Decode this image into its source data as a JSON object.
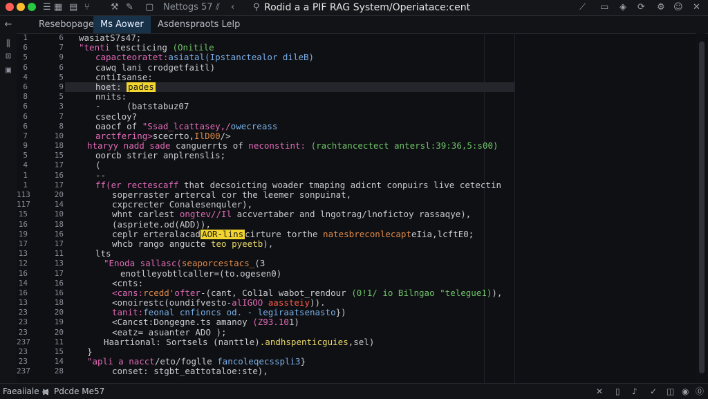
{
  "titlebar": {
    "tab_label": "Nettogs 57",
    "title": "Rodid a a PIF RAG System/Operiatace:cent",
    "colors": {
      "close": "#ff5f57",
      "minimize": "#febc2e",
      "maximize": "#28c840"
    }
  },
  "tabs": [
    {
      "label": "Resebopage",
      "active": false
    },
    {
      "label": "Ms Aower",
      "active": true
    },
    {
      "label": "Asdenspraots  Lelp",
      "active": false
    }
  ],
  "gutter_a": [
    "1",
    "6",
    "5",
    "6",
    "4",
    "6",
    "8",
    "6",
    "6",
    "6",
    "7",
    "9",
    "5",
    "4",
    "1",
    "1",
    "113",
    "117",
    "15",
    "16",
    "19",
    "17",
    "13",
    "12",
    "16",
    "14",
    "16",
    "13",
    "23",
    "23",
    "23",
    "237",
    "23",
    "23",
    "237"
  ],
  "gutter_b": [
    "6",
    "7",
    "9",
    "6",
    "5",
    "9",
    "5",
    "3",
    "7",
    "8",
    "10",
    "18",
    "15",
    "17",
    "16",
    "17",
    "20",
    "14",
    "10",
    "18",
    "16",
    "17",
    "11",
    "13",
    "17",
    "16",
    "16",
    "18",
    "20",
    "19",
    "20",
    "11",
    "15",
    "14",
    "28"
  ],
  "code_lines": [
    {
      "indent": 0,
      "parts": [
        [
          "",
          "wasiatS7s47;"
        ]
      ]
    },
    {
      "indent": 0,
      "parts": [
        [
          "kw",
          "\"tenti "
        ],
        [
          "",
          "tescticing "
        ],
        [
          "st",
          "(Onitile"
        ]
      ]
    },
    {
      "indent": 2,
      "parts": [
        [
          "kw",
          "capacteoratet:"
        ],
        [
          "bl",
          "asiatal(Ipstanctealor dileB)"
        ]
      ]
    },
    {
      "indent": 2,
      "parts": [
        [
          "",
          "cawq lani crodgetfaitl)"
        ]
      ]
    },
    {
      "indent": 2,
      "parts": [
        [
          "",
          "cntiIsanse:"
        ]
      ]
    },
    {
      "indent": 2,
      "parts": [
        [
          "",
          "hoet: "
        ],
        [
          "mk",
          "pades"
        ]
      ],
      "highlight": true
    },
    {
      "indent": 2,
      "parts": [
        [
          "",
          "nnits:"
        ]
      ]
    },
    {
      "indent": 2,
      "parts": [
        [
          "",
          "-     (batstabuz07"
        ]
      ]
    },
    {
      "indent": 2,
      "parts": [
        [
          "",
          "csecloy?"
        ]
      ]
    },
    {
      "indent": 2,
      "parts": [
        [
          "",
          "oaocf of "
        ],
        [
          "kw",
          "\"Ssad_lcattasey,/"
        ],
        [
          "bl",
          "owecreass"
        ]
      ]
    },
    {
      "indent": 2,
      "parts": [
        [
          "kw",
          "arctfering>"
        ],
        [
          "",
          "scecrto,"
        ],
        [
          "or",
          "IlD00"
        ],
        [
          "",
          "/>"
        ]
      ]
    },
    {
      "indent": 1,
      "parts": [
        [
          "kw",
          "htaryy nadd sade "
        ],
        [
          "",
          "canguerrts of "
        ],
        [
          "kw",
          "neconstint: "
        ],
        [
          "st",
          "(rachtancectect antersl:39:36,5:s00)"
        ]
      ]
    },
    {
      "indent": 2,
      "parts": [
        [
          "",
          "oorcb strier anplrenslis;"
        ]
      ]
    },
    {
      "indent": 2,
      "parts": [
        [
          "",
          "("
        ]
      ]
    },
    {
      "indent": 2,
      "parts": [
        [
          "",
          "-- "
        ]
      ]
    },
    {
      "indent": 2,
      "parts": [
        [
          "kw",
          "ff(er rectescaff "
        ],
        [
          "",
          "that decsoicting woader tmaping adicnt conpuirs live cetecting"
        ]
      ]
    },
    {
      "indent": 4,
      "parts": [
        [
          "",
          "soperraster artercal cor the leemer sonpuinat,"
        ]
      ]
    },
    {
      "indent": 4,
      "parts": [
        [
          "",
          "cxpcrecter Conalesenquler),"
        ]
      ]
    },
    {
      "indent": 4,
      "parts": [
        [
          "",
          "whnt carlest "
        ],
        [
          "kw",
          "ongtev//Il "
        ],
        [
          "",
          "accvertaber and lngotrag/lnofictoy rassaqye),"
        ]
      ]
    },
    {
      "indent": 4,
      "parts": [
        [
          "",
          "(aspriete.od(ADD)),"
        ]
      ]
    },
    {
      "indent": 4,
      "parts": [
        [
          "",
          "ceplr erteralacad"
        ],
        [
          "mk",
          "AOR-lins"
        ],
        [
          "",
          "cirture torthe "
        ],
        [
          "or",
          "natesbreconlecapt"
        ],
        [
          "",
          "eIia,lcftE0;"
        ]
      ]
    },
    {
      "indent": 4,
      "parts": [
        [
          "",
          "whcb rango angucte "
        ],
        [
          "fn",
          "teo pyeetb"
        ],
        [
          "",
          "),"
        ]
      ]
    },
    {
      "indent": 2,
      "parts": [
        [
          "",
          "lts"
        ]
      ]
    },
    {
      "indent": 3,
      "parts": [
        [
          "kw",
          "\"Enoda sallasc("
        ],
        [
          "or",
          "seaporcestacs_"
        ],
        [
          "",
          "(3"
        ]
      ]
    },
    {
      "indent": 5,
      "parts": [
        [
          "",
          "enotlleyobtlcaller=(to.ogesen0)"
        ]
      ]
    },
    {
      "indent": 4,
      "parts": [
        [
          "",
          "<cnts:"
        ]
      ]
    },
    {
      "indent": 4,
      "parts": [
        [
          "kw",
          "<cans:"
        ],
        [
          "or",
          "rcedd'"
        ],
        [
          "kw",
          "ofter"
        ],
        [
          "",
          "-(cant, Col1al wabot_rendour "
        ],
        [
          "st",
          "(0!1/ io Bilngao \"telegue1)"
        ],
        [
          "",
          "),"
        ]
      ]
    },
    {
      "indent": 4,
      "parts": [
        [
          "",
          "<onoirestc(oundifvesto-"
        ],
        [
          "kw",
          "alIGOO "
        ],
        [
          "rd",
          "aassteiy"
        ],
        [
          "",
          "))."
        ]
      ]
    },
    {
      "indent": 4,
      "parts": [
        [
          "kw",
          "tanit:"
        ],
        [
          "bl",
          "feonal cnfioncs od. - legiraatsenasto"
        ],
        [
          "",
          "})"
        ]
      ]
    },
    {
      "indent": 4,
      "parts": [
        [
          "",
          "<Cancst:Dongegne.ts amanoy "
        ],
        [
          "kw",
          "(Z93.10"
        ],
        [
          "",
          "1)"
        ]
      ]
    },
    {
      "indent": 4,
      "parts": [
        [
          "",
          "<eatz= asuanter ADO );"
        ]
      ]
    },
    {
      "indent": 3,
      "parts": [
        [
          "",
          "Haartional: Sortsels (nanttle)"
        ],
        [
          "fn",
          ".andhspenticguies"
        ],
        [
          "",
          ",sel)"
        ]
      ]
    },
    {
      "indent": 1,
      "parts": [
        [
          "",
          "}"
        ]
      ]
    },
    {
      "indent": 1,
      "parts": [
        [
          "kw",
          "\"apli a nacct"
        ],
        [
          "",
          "/eto/foglle "
        ],
        [
          "bl",
          "fancoleqecsspli3"
        ],
        [
          "",
          "}"
        ]
      ]
    },
    {
      "indent": 4,
      "parts": [
        [
          "",
          "conset: stgbt_eattotaloe:ste),"
        ]
      ]
    }
  ],
  "status": {
    "left": "Faeaiiale ◀",
    "mid": "Pdcde Me57"
  }
}
